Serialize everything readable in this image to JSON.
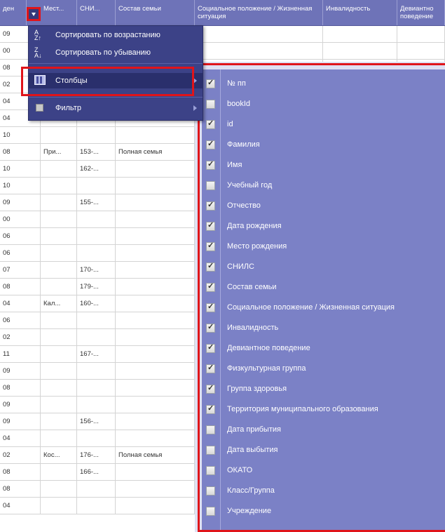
{
  "grid": {
    "headers": [
      "ден",
      "Мест...",
      "СНИ...",
      "Состав семьи",
      "Социальное положение / Жизненная ситуация",
      "Инвалидность",
      "Девиантно поведение"
    ],
    "rows": [
      [
        "09",
        "",
        "",
        "",
        "",
        "",
        ""
      ],
      [
        "00",
        "",
        "",
        "",
        "",
        "",
        ""
      ],
      [
        "08",
        "",
        "",
        "",
        "",
        "",
        ""
      ],
      [
        "02",
        "",
        "",
        "",
        "",
        "",
        ""
      ],
      [
        "04",
        "",
        "",
        "",
        "",
        "",
        ""
      ],
      [
        "04",
        "",
        "",
        "",
        "",
        "",
        ""
      ],
      [
        "10",
        "",
        "",
        "",
        "",
        "",
        ""
      ],
      [
        "08",
        "При...",
        "153-...",
        "Полная семья",
        "",
        "",
        ""
      ],
      [
        "10",
        "",
        "162-...",
        "",
        "",
        "",
        ""
      ],
      [
        "10",
        "",
        "",
        "",
        "",
        "",
        ""
      ],
      [
        "09",
        "",
        "155-...",
        "",
        "",
        "",
        ""
      ],
      [
        "00",
        "",
        "",
        "",
        "",
        "",
        ""
      ],
      [
        "06",
        "",
        "",
        "",
        "",
        "",
        ""
      ],
      [
        "06",
        "",
        "",
        "",
        "",
        "",
        ""
      ],
      [
        "07",
        "",
        "170-...",
        "",
        "",
        "",
        ""
      ],
      [
        "08",
        "",
        "179-...",
        "",
        "",
        "",
        ""
      ],
      [
        "04",
        "Кал...",
        "160-...",
        "",
        "",
        "",
        ""
      ],
      [
        "06",
        "",
        "",
        "",
        "",
        "",
        ""
      ],
      [
        "02",
        "",
        "",
        "",
        "",
        "",
        ""
      ],
      [
        "11",
        "",
        "167-...",
        "",
        "",
        "",
        ""
      ],
      [
        "09",
        "",
        "",
        "",
        "",
        "",
        ""
      ],
      [
        "08",
        "",
        "",
        "",
        "",
        "",
        ""
      ],
      [
        "09",
        "",
        "",
        "",
        "",
        "",
        ""
      ],
      [
        "09",
        "",
        "156-...",
        "",
        "",
        "",
        ""
      ],
      [
        "04",
        "",
        "",
        "",
        "",
        "",
        ""
      ],
      [
        "02",
        "Кос...",
        "176-...",
        "Полная семья",
        "",
        "",
        ""
      ],
      [
        "08",
        "",
        "166-...",
        "",
        "",
        "",
        ""
      ],
      [
        "08",
        "",
        "",
        "",
        "",
        "",
        ""
      ],
      [
        "04",
        "",
        "",
        "",
        "",
        "",
        ""
      ]
    ]
  },
  "menu": {
    "sort_asc": "Сортировать по возрастанию",
    "sort_desc": "Сортировать по убыванию",
    "columns": "Столбцы",
    "filter": "Фильтр"
  },
  "columns_submenu": {
    "items": [
      {
        "label": "№ пп",
        "checked": true
      },
      {
        "label": "bookId",
        "checked": false
      },
      {
        "label": "id",
        "checked": true
      },
      {
        "label": "Фамилия",
        "checked": true
      },
      {
        "label": "Имя",
        "checked": true
      },
      {
        "label": "Учебный год",
        "checked": false
      },
      {
        "label": "Отчество",
        "checked": true
      },
      {
        "label": "Дата рождения",
        "checked": true
      },
      {
        "label": "Место рождения",
        "checked": true
      },
      {
        "label": "СНИЛС",
        "checked": true
      },
      {
        "label": "Состав семьи",
        "checked": true
      },
      {
        "label": "Социальное положение / Жизненная ситуация",
        "checked": true
      },
      {
        "label": "Инвалидность",
        "checked": true
      },
      {
        "label": "Девиантное поведение",
        "checked": true
      },
      {
        "label": "Физкультурная группа",
        "checked": true
      },
      {
        "label": "Группа здоровья",
        "checked": true
      },
      {
        "label": "Территория муниципального образования",
        "checked": true
      },
      {
        "label": "Дата прибытия",
        "checked": false
      },
      {
        "label": "Дата выбытия",
        "checked": false
      },
      {
        "label": "ОКАТО",
        "checked": false
      },
      {
        "label": "Класс/Группа",
        "checked": false
      },
      {
        "label": "Учреждение",
        "checked": false
      }
    ]
  },
  "colors": {
    "header_bg": "#6e73b8",
    "menu_bg": "#3c4287",
    "submenu_bg": "#7b81c6",
    "highlight_frame": "#e0141a"
  }
}
